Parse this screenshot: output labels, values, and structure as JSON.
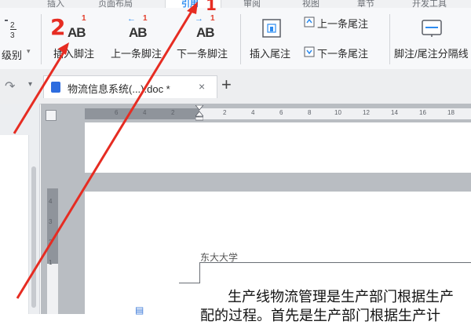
{
  "tabs": {
    "items": [
      "插入",
      "页面布局",
      "引用",
      "审阅",
      "视图",
      "章节",
      "开发工具"
    ],
    "active_index": 2
  },
  "ribbon": {
    "level_label": "级别",
    "insert_footnote": "插入脚注",
    "prev_footnote": "上一条脚注",
    "next_footnote": "下一条脚注",
    "insert_endnote": "插入尾注",
    "prev_endnote": "上一条尾注",
    "next_endnote": "下一条尾注",
    "separator_line": "脚注/尾注分隔线",
    "ab_text": "AB",
    "sup_one": "1"
  },
  "document_tab": {
    "name": "物流信息系统(...).doc *",
    "close": "×",
    "new_tab": "+"
  },
  "ruler": {
    "h_ticks": [
      "6",
      "4",
      "2",
      "2",
      "4",
      "6",
      "8",
      "10",
      "12",
      "14",
      "16",
      "18"
    ],
    "v_ticks": [
      "4",
      "3",
      "2",
      "1"
    ]
  },
  "page": {
    "header_text": "东大大学",
    "body_line1": "生产线物流管理是生产部门根据生产",
    "body_line2": "配的过程。首先是生产部门根据生产计"
  },
  "annotations": {
    "step1": "1",
    "step2": "2",
    "color": "#e62c22"
  }
}
